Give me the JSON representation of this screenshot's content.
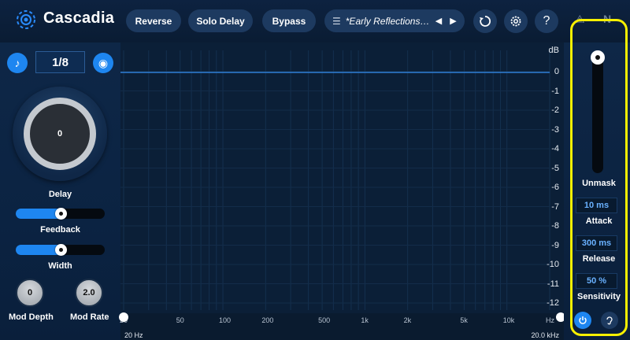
{
  "header": {
    "title": "Cascadia",
    "buttons": [
      "Reverse",
      "Solo Delay",
      "Bypass"
    ],
    "preset": {
      "list_icon": "☰",
      "name": "*Early Reflections - W...",
      "prev": "◀",
      "next": "▶"
    },
    "icons": [
      "undo-icon",
      "gear-icon",
      "help-icon"
    ],
    "help_glyph": "?",
    "brand_glyphs": [
      "⟁",
      "N"
    ]
  },
  "left": {
    "sync_glyph": "♪",
    "rate": "1/8",
    "ping_glyph": "◉",
    "delay": {
      "value": "0",
      "label": "Delay"
    },
    "feedback": {
      "label": "Feedback",
      "level": 0.5
    },
    "width": {
      "label": "Width",
      "level": 0.5
    },
    "mod_depth": {
      "value": "0",
      "label": "Mod Depth"
    },
    "mod_rate": {
      "value": "2.0",
      "label": "Mod Rate"
    }
  },
  "graph": {
    "db_unit": "dB",
    "db_ticks": [
      "0",
      "-1",
      "-2",
      "-3",
      "-4",
      "-5",
      "-6",
      "-7",
      "-8",
      "-9",
      "-10",
      "-11",
      "-12"
    ],
    "freq_ticks": [
      {
        "label": "20",
        "hz": 20
      },
      {
        "label": "50",
        "hz": 50
      },
      {
        "label": "100",
        "hz": 100
      },
      {
        "label": "200",
        "hz": 200
      },
      {
        "label": "500",
        "hz": 500
      },
      {
        "label": "1k",
        "hz": 1000
      },
      {
        "label": "2k",
        "hz": 2000
      },
      {
        "label": "5k",
        "hz": 5000
      },
      {
        "label": "10k",
        "hz": 10000
      },
      {
        "label": "Hz",
        "hz": 20000
      }
    ],
    "range_low": "20 Hz",
    "range_high": "20.0 kHz",
    "line_color": "#2f7fd6"
  },
  "right": {
    "unmask_label": "Unmask",
    "attack": {
      "value": "10 ms",
      "label": "Attack"
    },
    "release": {
      "value": "300 ms",
      "label": "Release"
    },
    "sensitivity": {
      "value": "50 %",
      "label": "Sensitivity"
    },
    "buttons": [
      "power-icon",
      "ear-icon"
    ],
    "highlight_color": "#f7f000"
  }
}
